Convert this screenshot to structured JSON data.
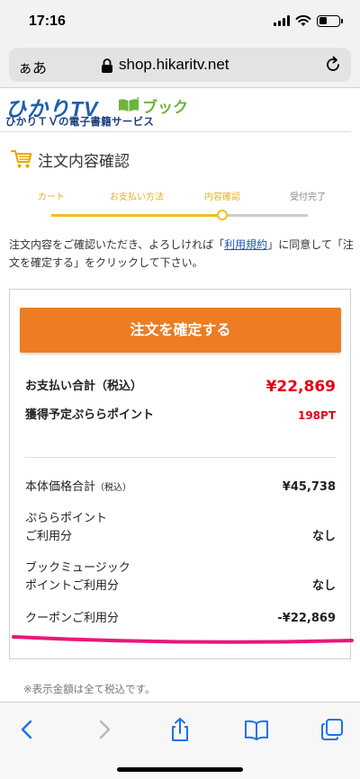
{
  "status_bar": {
    "time": "17:16",
    "battery_level": 0.4
  },
  "browser": {
    "text_size_label": "ぁあ",
    "url": "shop.hikaritv.net"
  },
  "logo": {
    "main": "ひかりTV",
    "book": "ブック",
    "sub": "ひかりＴＶの電子書籍サービス"
  },
  "page": {
    "title": "注文内容確認"
  },
  "steps": {
    "items": [
      {
        "label": "カート",
        "state": "done"
      },
      {
        "label": "お支払い方法",
        "state": "done"
      },
      {
        "label": "内容確認",
        "state": "current"
      },
      {
        "label": "受付完了",
        "state": "todo"
      }
    ]
  },
  "notice": {
    "before": "注文内容をご確認いただき、よろしければ「",
    "link": "利用規約",
    "after": "」に同意して「注文を確定する」をクリックして下さい。"
  },
  "order": {
    "confirm_label": "注文を確定する",
    "total_label": "お支払い合計（税込）",
    "total_value": "¥22,869",
    "points_label": "獲得予定ぷららポイント",
    "points_value": "198PT",
    "subtotal_label": "本体価格合計",
    "subtotal_suffix": "（税込）",
    "subtotal_value": "¥45,738",
    "plala_label_1": "ぷららポイント",
    "plala_label_2": "ご利用分",
    "plala_value": "なし",
    "music_label_1": "ブックミュージック",
    "music_label_2": "ポイントご利用分",
    "music_value": "なし",
    "coupon_label": "クーポンご利用分",
    "coupon_value": "-¥22,869"
  },
  "footnote": "※表示金額は全て税込です。",
  "colors": {
    "accent": "#ec7d23",
    "price": "#e60012",
    "step_active": "#f0c020",
    "highlight": "#e8177a",
    "link": "#1a57b4"
  },
  "toolbar": {
    "icons": [
      "back-icon",
      "forward-icon",
      "share-icon",
      "bookmarks-icon",
      "tabs-icon"
    ]
  }
}
